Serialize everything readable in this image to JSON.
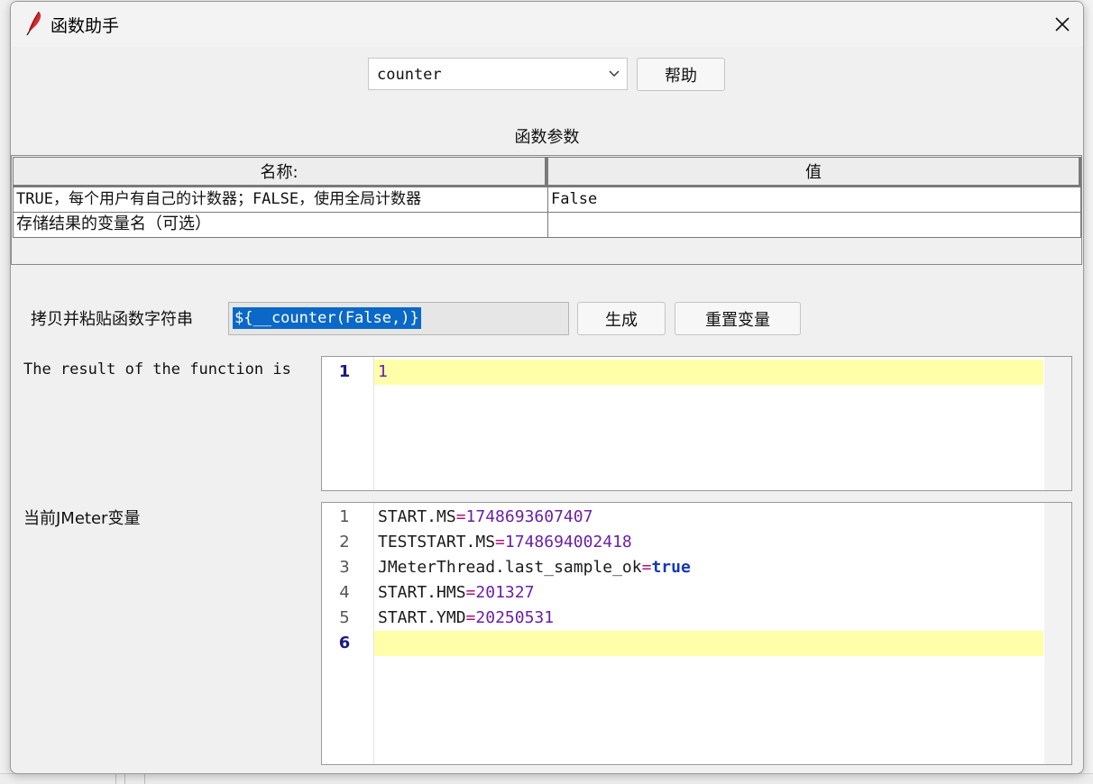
{
  "window": {
    "title": "函数助手",
    "app_icon": "feather-icon",
    "close_icon": "close-icon"
  },
  "function_select": {
    "value": "counter",
    "icon": "chevron-down-icon"
  },
  "help_button": "帮助",
  "params_section": {
    "title": "函数参数",
    "headers": [
      "名称:",
      "值"
    ],
    "rows": [
      {
        "name": "TRUE，每个用户有自己的计数器；FALSE，使用全局计数器",
        "value": "False"
      },
      {
        "name": "存储结果的变量名（可选）",
        "value": ""
      }
    ]
  },
  "function_string": {
    "label": "拷贝并粘贴函数字符串",
    "value": "${__counter(False,)}",
    "generate_button": "生成",
    "reset_button": "重置变量"
  },
  "result": {
    "label": "The result of the function is",
    "lines": [
      {
        "no": "1",
        "text": "1"
      }
    ]
  },
  "variables": {
    "label": "当前JMeter变量",
    "lines": [
      {
        "no": "1",
        "key": "START.MS",
        "eq": "=",
        "value": "1748693607407"
      },
      {
        "no": "2",
        "key": "TESTSTART.MS",
        "eq": "=",
        "value": "1748694002418"
      },
      {
        "no": "3",
        "key": "JMeterThread.last_sample_ok",
        "eq": "=",
        "value": "true"
      },
      {
        "no": "4",
        "key": "START.HMS",
        "eq": "=",
        "value": "201327"
      },
      {
        "no": "5",
        "key": "START.YMD",
        "eq": "=",
        "value": "20250531"
      },
      {
        "no": "6",
        "key": "",
        "eq": "",
        "value": ""
      }
    ]
  },
  "colors": {
    "highlight_line": "#ffffaa",
    "selection": "#0a68c8",
    "number": "#6a1fa8",
    "keyword": "#1838b8",
    "operator": "#b1137e"
  }
}
